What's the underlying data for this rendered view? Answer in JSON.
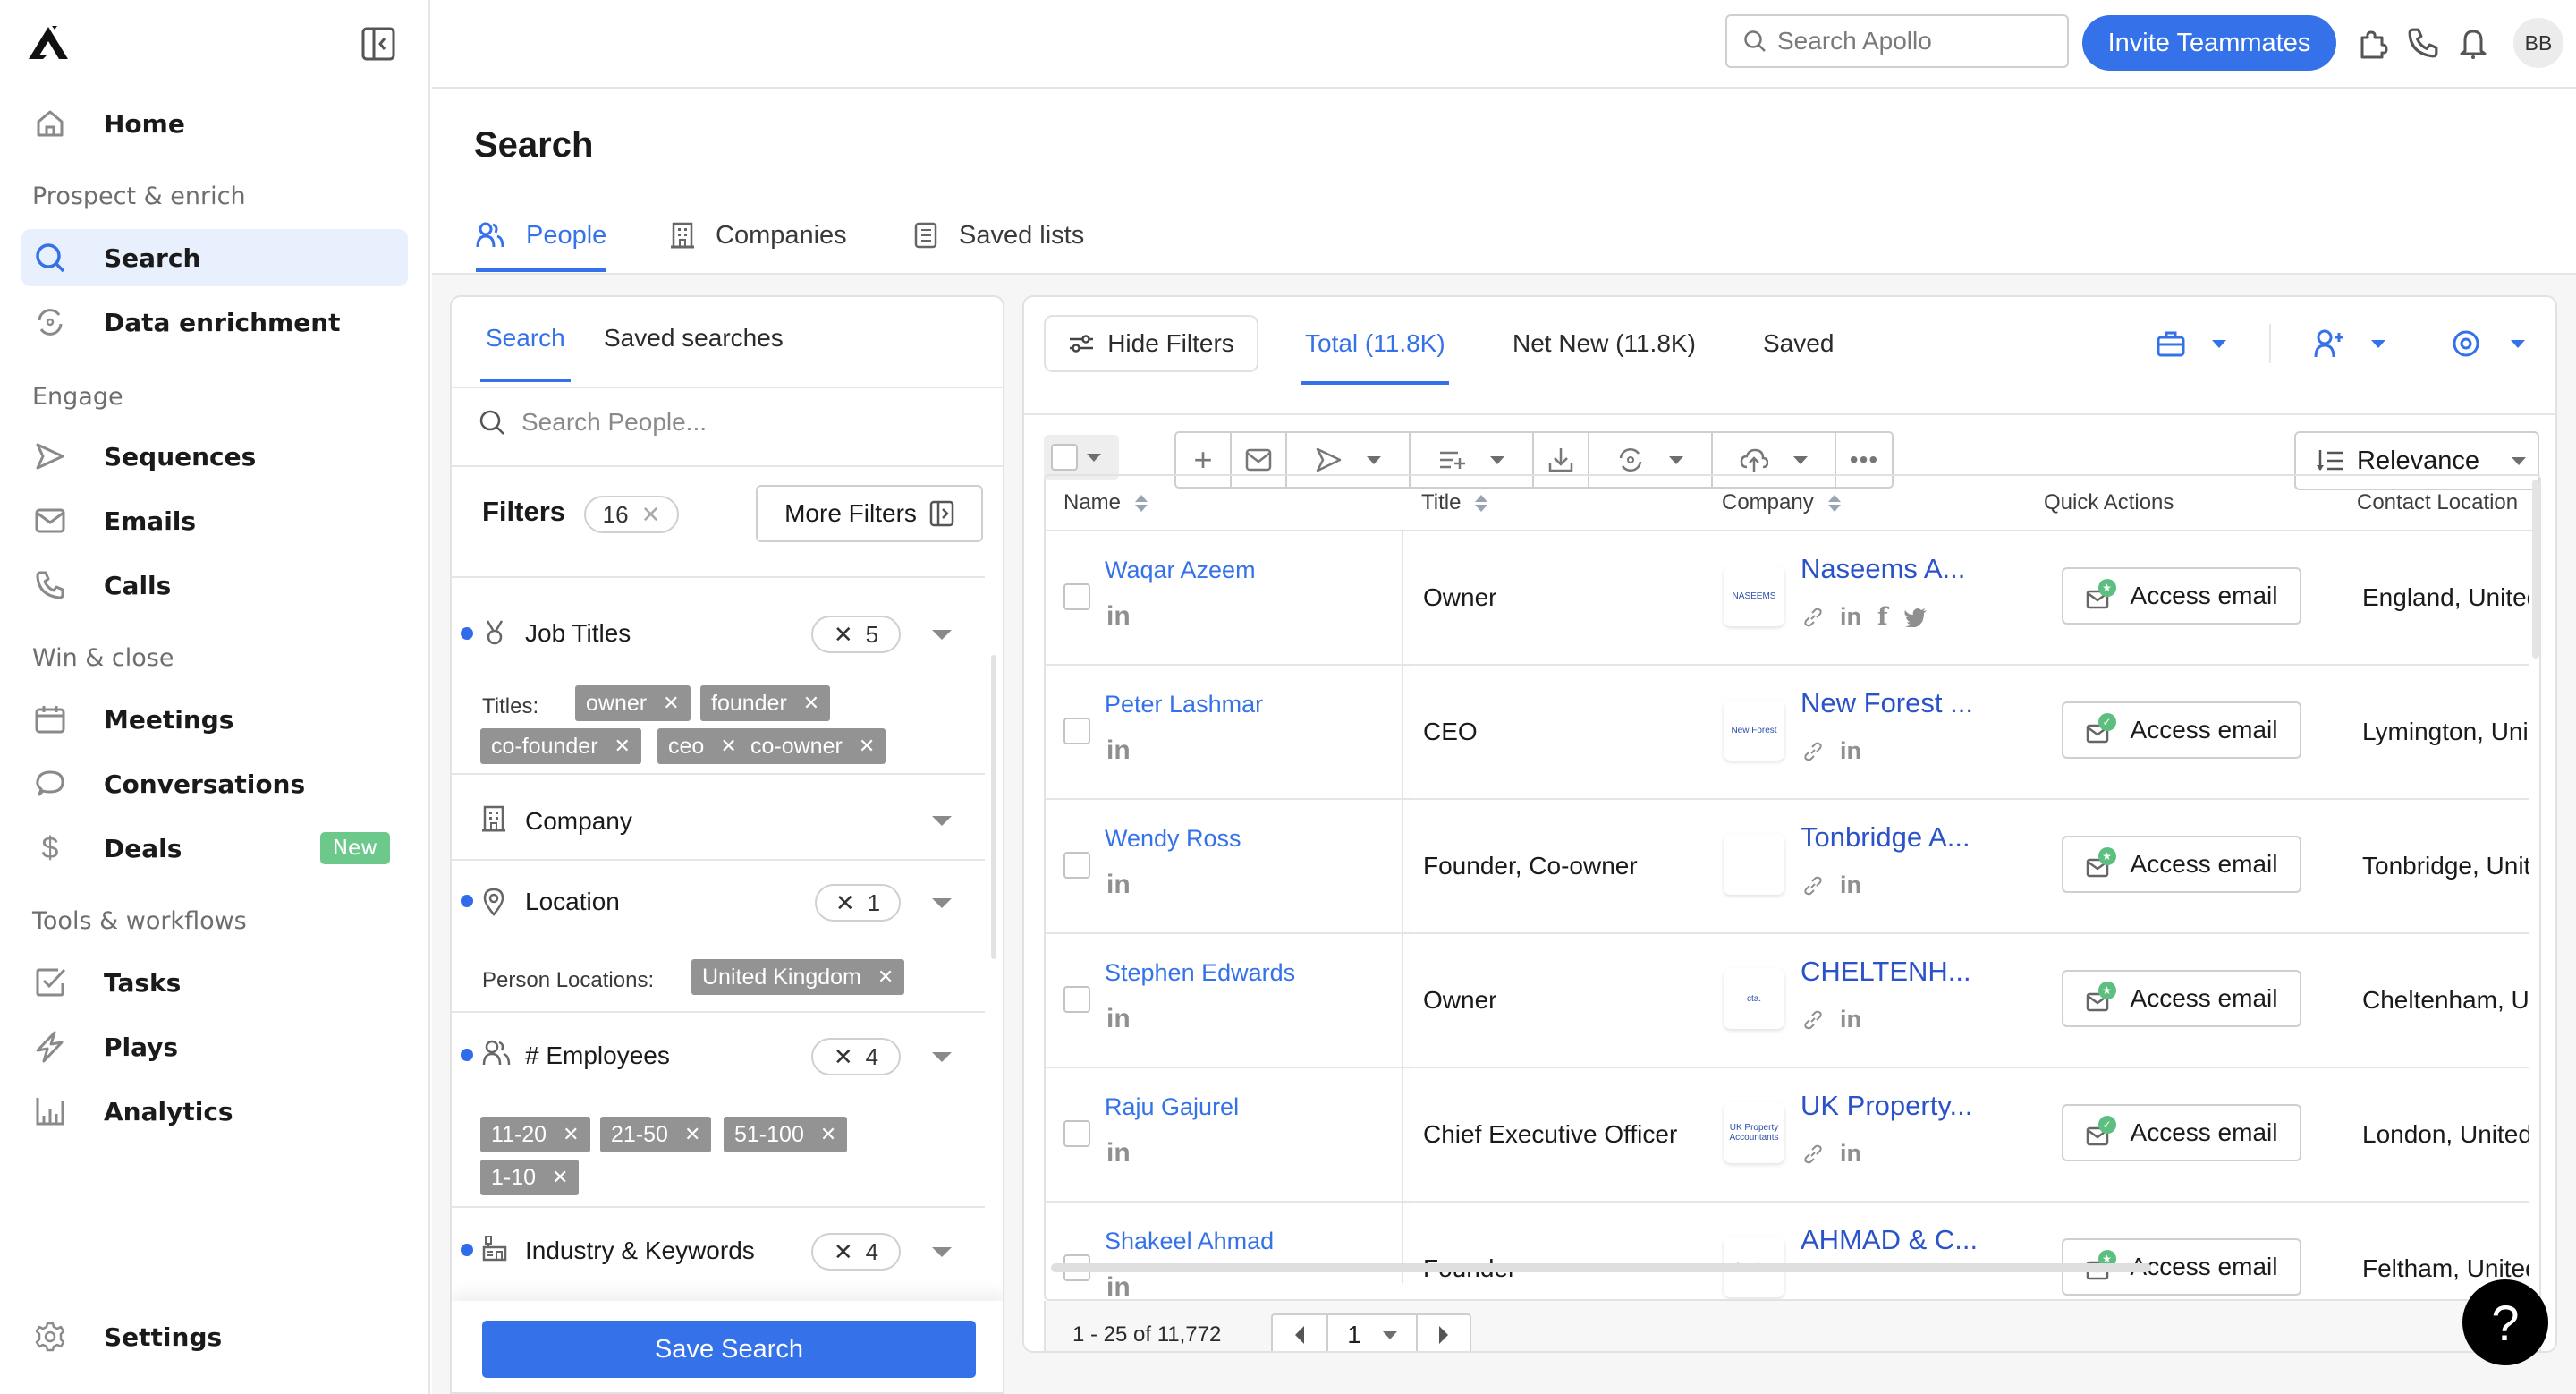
{
  "sidebar": {
    "sections": {
      "prospect": "Prospect & enrich",
      "engage": "Engage",
      "win": "Win & close",
      "tools": "Tools & workflows"
    },
    "items": {
      "home": "Home",
      "search": "Search",
      "data_enrichment": "Data enrichment",
      "sequences": "Sequences",
      "emails": "Emails",
      "calls": "Calls",
      "meetings": "Meetings",
      "conversations": "Conversations",
      "deals": "Deals",
      "deals_badge": "New",
      "tasks": "Tasks",
      "plays": "Plays",
      "analytics": "Analytics",
      "settings": "Settings"
    }
  },
  "topbar": {
    "search_placeholder": "Search Apollo",
    "invite_label": "Invite Teammates",
    "avatar_initials": "BB"
  },
  "page": {
    "title": "Search",
    "tabs": {
      "people": "People",
      "companies": "Companies",
      "saved_lists": "Saved lists"
    }
  },
  "filters": {
    "tabs": {
      "search": "Search",
      "saved_searches": "Saved searches"
    },
    "search_placeholder": "Search People...",
    "title": "Filters",
    "total_count": "16",
    "more_filters_label": "More Filters",
    "job_titles": {
      "label": "Job Titles",
      "count": "5",
      "sub_label": "Titles:",
      "chips": [
        "owner",
        "founder",
        "co-founder",
        "ceo",
        "co-owner"
      ]
    },
    "company": {
      "label": "Company"
    },
    "location": {
      "label": "Location",
      "count": "1",
      "sub_label": "Person Locations:",
      "chips": [
        "United Kingdom"
      ]
    },
    "employees": {
      "label": "# Employees",
      "count": "4",
      "chips": [
        "11-20",
        "21-50",
        "51-100",
        "1-10"
      ]
    },
    "industry": {
      "label": "Industry & Keywords",
      "count": "4"
    },
    "save_search_label": "Save Search"
  },
  "results": {
    "hide_filters_label": "Hide Filters",
    "tabs": {
      "total": "Total (11.8K)",
      "net_new": "Net New (11.8K)",
      "saved": "Saved"
    },
    "sort_label": "Relevance",
    "columns": {
      "name": "Name",
      "title": "Title",
      "company": "Company",
      "quick_actions": "Quick Actions",
      "contact_location": "Contact Location"
    },
    "access_email_label": "Access email",
    "linkedin_glyph": "in",
    "rows": [
      {
        "name": "Waqar Azeem",
        "title": "Owner",
        "company": "Naseems A...",
        "logo_text": "NASEEMS",
        "location": "England, United Kingdom",
        "email_status": "star",
        "company_links": [
          "link",
          "linkedin",
          "facebook",
          "twitter"
        ]
      },
      {
        "name": "Peter Lashmar",
        "title": "CEO",
        "company": "New Forest ...",
        "logo_text": "New Forest",
        "location": "Lymington, United Kingdom",
        "email_status": "check",
        "company_links": [
          "link",
          "linkedin"
        ]
      },
      {
        "name": "Wendy Ross",
        "title": "Founder, Co-owner",
        "company": "Tonbridge A...",
        "logo_text": "",
        "location": "Tonbridge, United Kingdom",
        "email_status": "star",
        "company_links": [
          "link",
          "linkedin"
        ]
      },
      {
        "name": "Stephen Edwards",
        "title": "Owner",
        "company": "CHELTENH...",
        "logo_text": "cta.",
        "location": "Cheltenham, United Kingdom",
        "email_status": "star",
        "company_links": [
          "link",
          "linkedin"
        ]
      },
      {
        "name": "Raju Gajurel",
        "title": "Chief Executive Officer",
        "company": "UK Property...",
        "logo_text": "UK Property Accountants",
        "location": "London, United Kingdom",
        "email_status": "check",
        "company_links": [
          "link",
          "linkedin"
        ]
      },
      {
        "name": "Shakeel Ahmad",
        "title": "Founder",
        "company": "AHMAD & C...",
        "logo_text": "Ahmad&Co",
        "location": "Feltham, United Kingdom",
        "email_status": "star",
        "company_links": []
      }
    ],
    "pagination": {
      "range_text": "1 - 25 of 11,772",
      "current_page": "1"
    }
  },
  "help_label": "?",
  "colors": {
    "accent": "#3572ea",
    "badge_green": "#6cc98b",
    "chip_grey": "#939393"
  }
}
